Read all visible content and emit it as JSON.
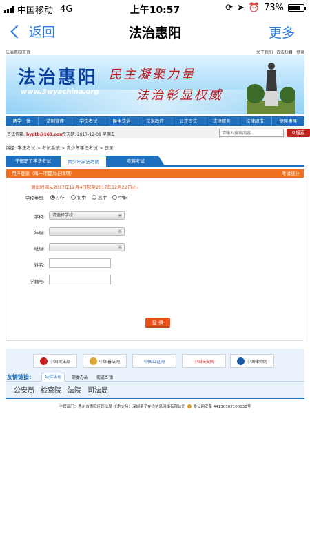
{
  "status_bar": {
    "carrier": "中国移动",
    "network": "4G",
    "time": "上午10:57",
    "battery": "73%"
  },
  "nav": {
    "back_label": "返回",
    "title": "法治惠阳",
    "more_label": "更多"
  },
  "site": {
    "home_link": "法治惠阳首页",
    "top_links": [
      "关于我们",
      "普法栏目",
      "登录"
    ],
    "banner_title": "法治惠阳",
    "banner_url": "www.3wyachina.org",
    "slogan_1": "民主凝聚力量",
    "slogan_2": "法治彰显权威",
    "menu": [
      "两学一做",
      "法制宣传",
      "学法考试",
      "民主法治",
      "法治政府",
      "公正司法",
      "法律服务",
      "法律超市",
      "便民惠民"
    ],
    "mailbox_label": "普法信箱:",
    "mailbox_email": "hyptb@163.com",
    "today_label": "今天是: 2017-12-08 星期五",
    "search_placeholder": "请输入搜索内容",
    "search_button": "搜索"
  },
  "breadcrumb": "路径: 学法考试 > 考试系统 > 青少年学法考试 > 登录",
  "tabs": [
    {
      "label": "干部职工学法考试",
      "active": false
    },
    {
      "label": "青少年学法考试",
      "active": true
    },
    {
      "label": "竞赛考试",
      "active": false
    }
  ],
  "form": {
    "header_title": "用户登录（每一项都为必填项）",
    "header_right": "考试统计",
    "notice": "测试时间从2017年12月4日起至2017年12月22日止。",
    "school_type_label": "学校类型:",
    "school_types": [
      {
        "label": "小学",
        "selected": true
      },
      {
        "label": "初中",
        "selected": false
      },
      {
        "label": "高中",
        "selected": false
      },
      {
        "label": "中职",
        "selected": false
      }
    ],
    "school_label": "学校:",
    "school_value": "请选择学校",
    "grade_label": "年级:",
    "grade_value": "",
    "class_label": "班级:",
    "class_value": "",
    "name_label": "姓名:",
    "name_value": "",
    "student_id_label": "学籍号:",
    "student_id_value": "",
    "login_button": "登 录"
  },
  "friend_logos": [
    {
      "label": "中国司法部",
      "sub": "www.moj.gov.cn",
      "color": "#c42020"
    },
    {
      "label": "中国普法网",
      "sub": "legalinfo.gov.cn",
      "color": "#1a5aa8"
    },
    {
      "label": "中国公证网",
      "sub": "www.chinanotary.org",
      "color": "#1a5aa8"
    },
    {
      "label": "中国长安网",
      "sub": "www.chinapeace.org.cn",
      "color": "#c42020"
    },
    {
      "label": "中国律师网",
      "sub": "www.acla.org.cn",
      "color": "#1a5aa8"
    }
  ],
  "friend_links": {
    "title": "友情链接:",
    "tabs": [
      "公检法司",
      "部委办局",
      "街道乡镇"
    ],
    "items": [
      "公安局",
      "检察院",
      "法院",
      "司法局"
    ]
  },
  "footer": {
    "text": "主管部门：惠州市惠阳区司法局   技术支持：深圳量子在线信息网络有限公司",
    "icp": "粤公网安备 44130302100038号"
  }
}
